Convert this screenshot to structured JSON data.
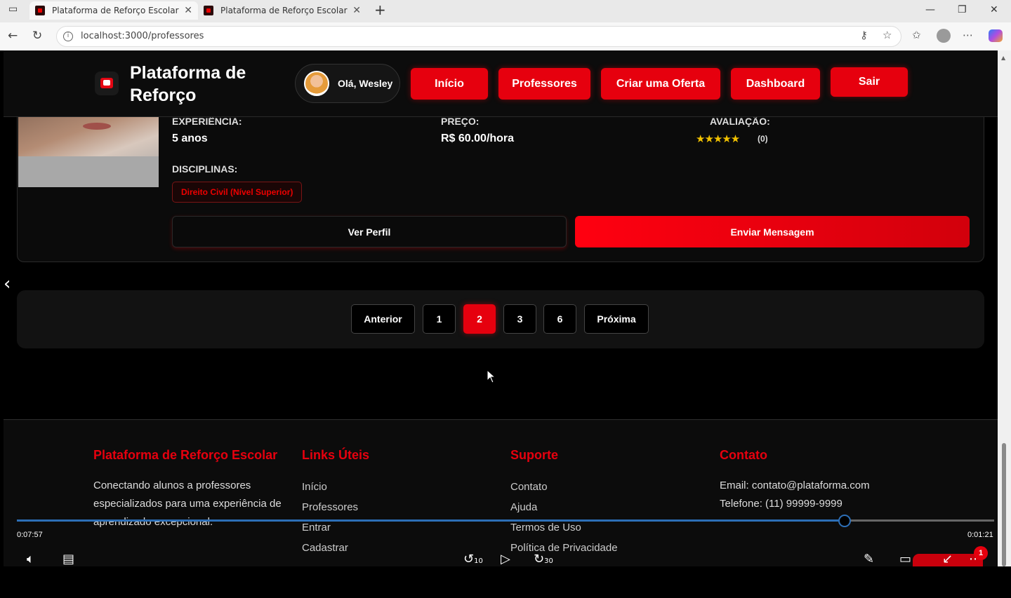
{
  "browser": {
    "tabs": [
      {
        "title": "Plataforma de Reforço Escolar",
        "active": true
      },
      {
        "title": "Plataforma de Reforço Escolar",
        "active": false
      }
    ],
    "url": "localhost:3000/professores",
    "new_tab_glyph": "+",
    "window_controls": {
      "minimize": "—",
      "maximize": "❐",
      "close": "✕"
    }
  },
  "header": {
    "logo_text": "Plataforma de Reforço",
    "greeting": "Olá, Wesley",
    "nav": [
      {
        "label": "Início"
      },
      {
        "label": "Professores"
      },
      {
        "label": "Criar uma Oferta"
      },
      {
        "label": "Dashboard"
      },
      {
        "label": "Sair"
      }
    ]
  },
  "teacher_card": {
    "experience_label": "EXPERIÊNCIA:",
    "experience_value": "5 anos",
    "price_label": "PREÇO:",
    "price_value": "R$ 60.00/hora",
    "rating_label": "AVALIAÇÃO:",
    "stars": "★★★★★",
    "rating_count": "(0)",
    "rating_value": 0,
    "subjects_label": "DISCIPLINAS:",
    "subjects": [
      "Direito Civil (Nível Superior)"
    ],
    "view_profile_label": "Ver Perfil",
    "send_message_label": "Enviar Mensagem"
  },
  "pagination": {
    "previous_label": "Anterior",
    "pages": [
      "1",
      "2",
      "3",
      "6"
    ],
    "current_page": "2",
    "next_label": "Próxima"
  },
  "footer": {
    "brand_title": "Plataforma de Reforço Escolar",
    "brand_text": "Conectando alunos a professores especializados para uma experiência de aprendizado excepcional.",
    "links_title": "Links Úteis",
    "links": [
      "Início",
      "Professores",
      "Entrar",
      "Cadastrar"
    ],
    "support_title": "Suporte",
    "support_links": [
      "Contato",
      "Ajuda",
      "Termos de Uso",
      "Política de Privacidade"
    ],
    "contact_title": "Contato",
    "contact_email": "Email: contato@plataforma.com",
    "contact_phone": "Telefone: (11) 99999-9999"
  },
  "video_player": {
    "elapsed": "0:07:57",
    "remaining": "0:01:21",
    "progress": 0.847,
    "skip_back": "10",
    "skip_forward": "30",
    "notification_count": "1"
  },
  "colors": {
    "accent_red": "#e6000e",
    "background": "#000000",
    "star_yellow": "#f2c200",
    "video_progress_blue": "#2d6fb7"
  }
}
